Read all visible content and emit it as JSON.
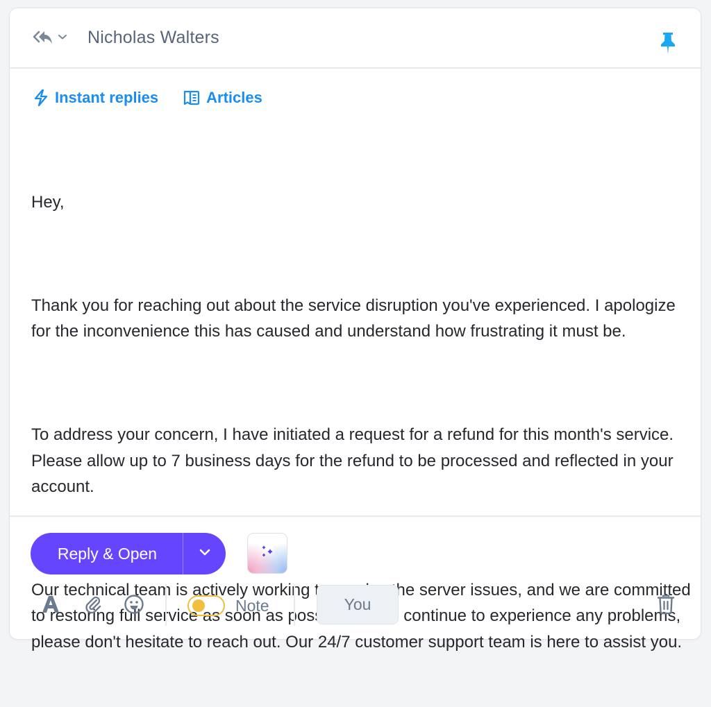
{
  "header": {
    "reply_type_icon": "reply-all-icon",
    "reply_type_dropdown_icon": "chevron-down-icon",
    "recipient_name": "Nicholas Walters",
    "pin_icon": "pin-icon"
  },
  "toolbar_links": [
    {
      "icon": "lightning-icon",
      "label": "Instant replies"
    },
    {
      "icon": "book-icon",
      "label": "Articles"
    }
  ],
  "message": {
    "paragraphs": [
      "Hey,",
      "Thank you for reaching out about the service disruption you've experienced. I apologize for the inconvenience this has caused and understand how frustrating it must be.",
      "To address your concern, I have initiated a request for a refund for this month's service. Please allow up to 7 business days for the refund to be processed and reflected in your account.",
      "Our technical team is actively working to resolve the server issues, and we are committed to restoring full service as soon as possible. If you continue to experience any problems, please don't hesitate to reach out. Our 24/7 customer support team is here to assist you."
    ]
  },
  "actions": {
    "reply_button_label": "Reply & Open",
    "reply_dropdown_icon": "chevron-down-icon",
    "ai_button_icon": "sparkles-icon"
  },
  "composer_tools": {
    "format_icon": "text-format-icon",
    "attach_icon": "paperclip-icon",
    "emoji_icon": "smiley-icon",
    "note_toggle": {
      "label": "Note",
      "on": false
    },
    "assignee_button_label": "You",
    "delete_icon": "trash-icon"
  },
  "colors": {
    "primary": "#6645ff",
    "link": "#1b8cf0",
    "pin": "#1aa7f5",
    "note_toggle": "#f0bf3c",
    "muted_icon": "#6b7a8e",
    "text": "#26282d"
  }
}
